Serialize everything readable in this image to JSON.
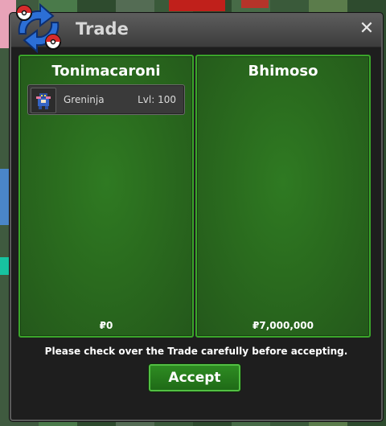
{
  "window": {
    "title": "Trade",
    "close_label": "✕"
  },
  "left_trader": {
    "name": "Tonimacaroni",
    "items": [
      {
        "name": "Greninja",
        "level": "Lvl: 100",
        "icon": "greninja-sprite-icon"
      }
    ],
    "money": "₽0"
  },
  "right_trader": {
    "name": "Bhimoso",
    "items": [],
    "money": "₽7,000,000"
  },
  "notice": "Please check over the Trade carefully before accepting.",
  "accept_label": "Accept",
  "colors": {
    "panel_green": "#2a6b1e",
    "panel_border": "#3aa52a",
    "accept_green": "#2e8c22"
  }
}
